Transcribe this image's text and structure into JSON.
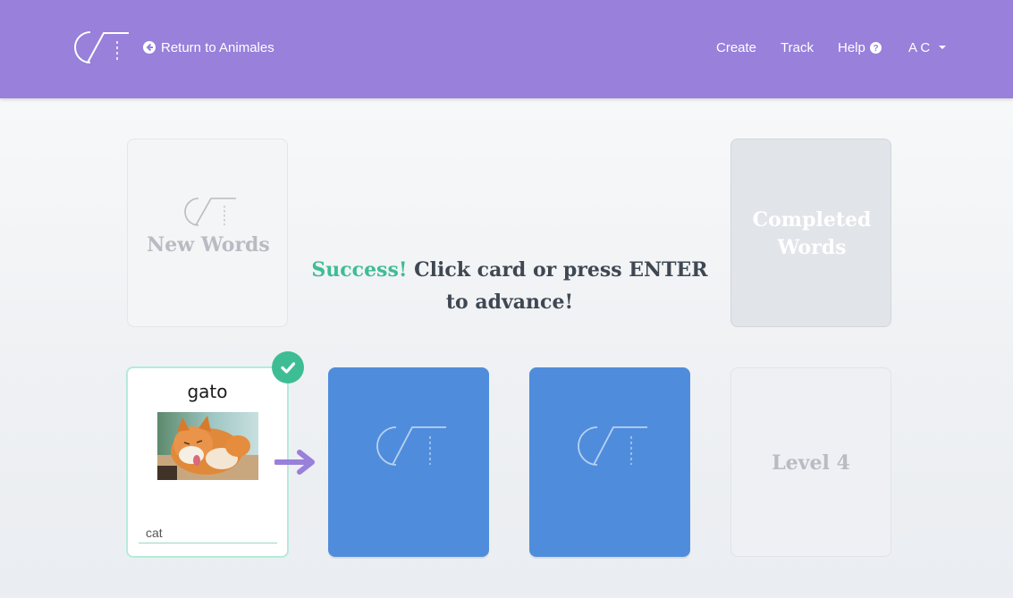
{
  "header": {
    "return_label": "Return to Animales",
    "nav": {
      "create": "Create",
      "track": "Track",
      "help": "Help",
      "user": "A C"
    },
    "bg_color": "#9880db"
  },
  "decks": {
    "new_words": "New Words",
    "completed_words_line1": "Completed",
    "completed_words_line2": "Words"
  },
  "message": {
    "success": "Success!",
    "line1_rest": " Click card or press ENTER",
    "line2": "to advance!"
  },
  "current_card": {
    "word": "gato",
    "answer": "cat",
    "status": "correct",
    "image": "cat-photo"
  },
  "level": {
    "label": "Level 4"
  },
  "colors": {
    "accent": "#9880db",
    "success": "#3ebd95",
    "card_blue": "#4f8ddc"
  },
  "icons": [
    "logo",
    "return-arrow-icon",
    "help-icon",
    "caret-down-icon",
    "check-icon",
    "arrow-right-icon"
  ]
}
